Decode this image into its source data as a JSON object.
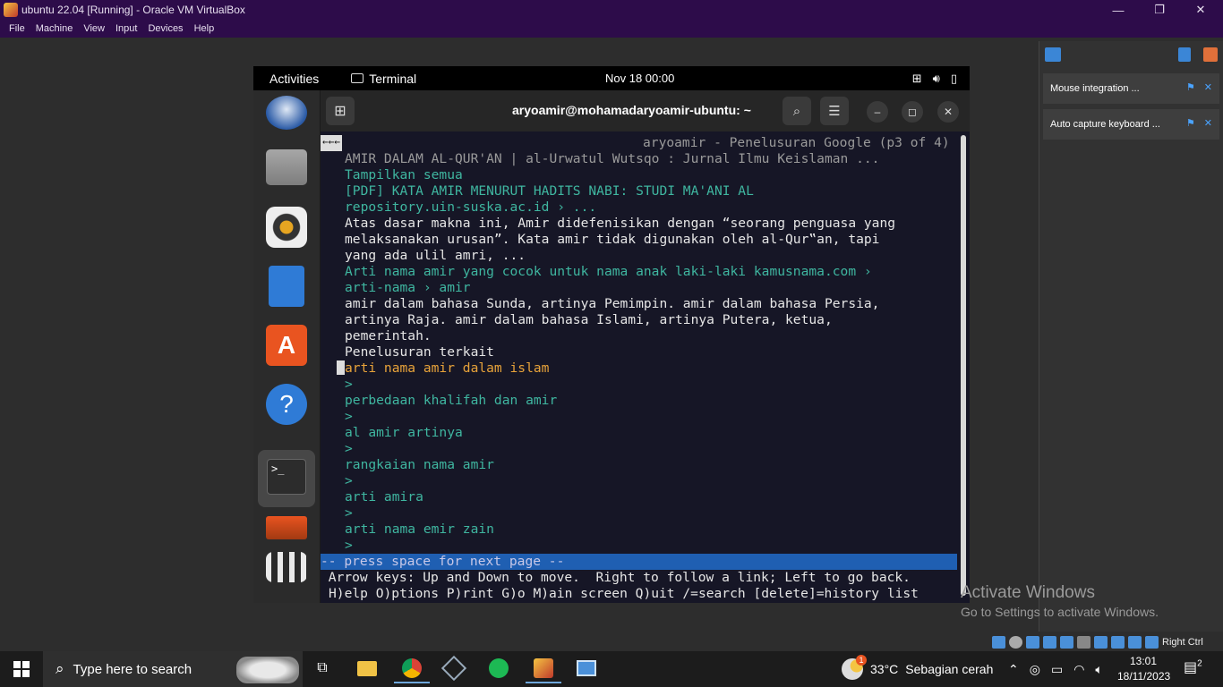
{
  "host": {
    "window_title": "ubuntu 22.04 [Running] - Oracle VM VirtualBox",
    "menu": [
      "File",
      "Machine",
      "View",
      "Input",
      "Devices",
      "Help"
    ],
    "window_controls": {
      "minimize": "—",
      "restore": "❐",
      "close": "✕"
    },
    "notifications": [
      {
        "label": "Mouse integration ..."
      },
      {
        "label": "Auto capture keyboard ..."
      }
    ],
    "activate": {
      "title": "Activate Windows",
      "subtitle": "Go to Settings to activate Windows."
    },
    "host_key": "Right Ctrl"
  },
  "guest": {
    "topbar": {
      "activities": "Activities",
      "app_name": "Terminal",
      "datetime": "Nov 18  00:00"
    },
    "dock_items": [
      "thunderbird-icon",
      "files-icon",
      "rhythmbox-icon",
      "writer-icon",
      "app-center-icon",
      "help-icon",
      "terminal-icon",
      "disk-icon",
      "show-apps-icon"
    ],
    "terminal": {
      "title": "aryoamir@mohamadaryoamir-ubuntu: ~",
      "nav_arrows": "←←←",
      "page_header": "aryoamir - Penelusuran Google (p3 of 4)",
      "lines": [
        {
          "text": "AMIR DALAM AL-QUR'AN | al-Urwatul Wutsqo : Jurnal Ilmu Keislaman ...",
          "style": "gray"
        },
        {
          "text": "Tampilkan semua",
          "style": "cyan"
        },
        {
          "text": "[PDF] KATA AMIR MENURUT HADITS NABI: STUDI MA'ANI AL",
          "style": "cyan"
        },
        {
          "text": "repository.uin-suska.ac.id › ...",
          "style": "cyan"
        },
        {
          "text": "Atas dasar makna ini, Amir didefenisikan dengan “seorang penguasa yang",
          "style": "plain"
        },
        {
          "text": "melaksanakan urusan”. Kata amir tidak digunakan oleh al-Qur‟an, tapi",
          "style": "plain"
        },
        {
          "text": "yang ada ulil amri, ...",
          "style": "plain"
        },
        {
          "text": "Arti nama amir yang cocok untuk nama anak laki-laki kamusnama.com ›",
          "style": "cyan"
        },
        {
          "text": "arti-nama › amir",
          "style": "cyan"
        },
        {
          "text": "amir dalam bahasa Sunda, artinya Pemimpin. amir dalam bahasa Persia,",
          "style": "plain"
        },
        {
          "text": "artinya Raja. amir dalam bahasa Islami, artinya Putera, ketua,",
          "style": "plain"
        },
        {
          "text": "pemerintah.",
          "style": "plain"
        },
        {
          "text": "Penelusuran terkait",
          "style": "plain"
        },
        {
          "text": "arti nama amir dalam islam",
          "style": "orange"
        },
        {
          "text": ">",
          "style": "cyan"
        },
        {
          "text": "perbedaan khalifah dan amir",
          "style": "cyan"
        },
        {
          "text": ">",
          "style": "cyan"
        },
        {
          "text": "al amir artinya",
          "style": "cyan"
        },
        {
          "text": ">",
          "style": "cyan"
        },
        {
          "text": "rangkaian nama amir",
          "style": "cyan"
        },
        {
          "text": ">",
          "style": "cyan"
        },
        {
          "text": "arti amira",
          "style": "cyan"
        },
        {
          "text": ">",
          "style": "cyan"
        },
        {
          "text": "arti nama emir zain",
          "style": "cyan"
        },
        {
          "text": ">",
          "style": "cyan"
        }
      ],
      "status": "-- press space for next page --",
      "help1": " Arrow keys: Up and Down to move.  Right to follow a link; Left to go back.",
      "help2": "H)elp O)ptions P)rint G)o M)ain screen Q)uit /=search [delete]=history list"
    }
  },
  "taskbar": {
    "search_placeholder": "Type here to search",
    "weather_badge": "1",
    "weather_temp": "33°C",
    "weather_desc": "Sebagian cerah",
    "time": "13:01",
    "date": "18/11/2023",
    "notification_count": "2"
  },
  "colors": {
    "host_chrome": "#2d0c4a",
    "terminal_bg": "#161626",
    "link": "#3fb6a0",
    "selected_link": "#e8a33a",
    "status_bar": "#1f5fb2"
  }
}
